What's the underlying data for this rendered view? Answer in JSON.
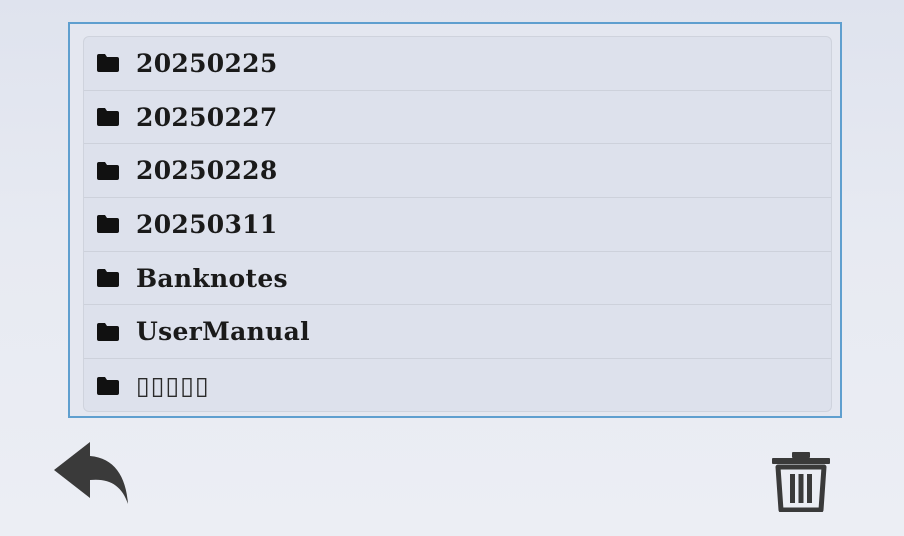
{
  "file_list": {
    "items": [
      {
        "label": "20250225",
        "icon": "folder-icon"
      },
      {
        "label": "20250227",
        "icon": "folder-icon"
      },
      {
        "label": "20250228",
        "icon": "folder-icon"
      },
      {
        "label": "20250311",
        "icon": "folder-icon"
      },
      {
        "label": "Banknotes",
        "icon": "folder-icon"
      },
      {
        "label": "UserManual",
        "icon": "folder-icon"
      },
      {
        "label": "▯▯▯▯▯",
        "icon": "folder-icon"
      }
    ]
  },
  "toolbar": {
    "back_icon": "back-arrow-icon",
    "delete_icon": "trash-icon"
  },
  "colors": {
    "panel_border": "#5f9fcf",
    "icon": "#3a3a3a"
  }
}
